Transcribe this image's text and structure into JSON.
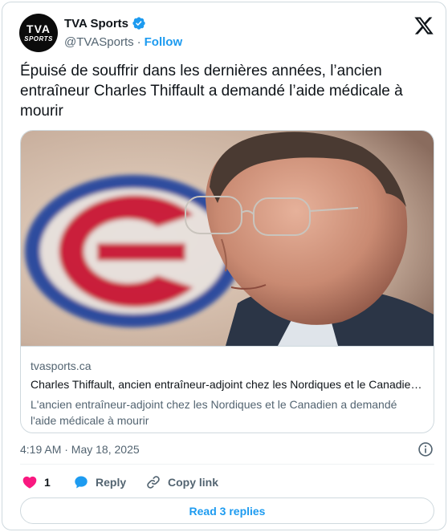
{
  "author": {
    "avatar_line1": "TVA",
    "avatar_line2": "SPORTS",
    "name": "TVA Sports",
    "handle": "@TVASports",
    "separator": "·",
    "follow_label": "Follow",
    "verified": true
  },
  "tweet": {
    "text": "Épuisé de souffrir dans les dernières années, l’ancien entraîneur Charles Thiffault a demandé l’aide médicale à mourir"
  },
  "link_card": {
    "domain": "tvasports.ca",
    "title": "Charles Thiffault, ancien entraîneur-adjoint chez les Nordiques et le Canadien a demandé l'aide médicale à mourir",
    "description": "L'ancien entraîneur-adjoint chez les Nordiques et le Canadien a demandé l'aide médicale à mourir"
  },
  "meta": {
    "timestamp": "4:19 AM · May 18, 2025"
  },
  "actions": {
    "like_count": "1",
    "reply_label": "Reply",
    "copy_label": "Copy link"
  },
  "footer": {
    "read_replies_label": "Read 3 replies"
  },
  "colors": {
    "accent": "#1d9bf0",
    "like": "#f91880",
    "text": "#0f1419",
    "secondary": "#536471",
    "border": "#cfd9de"
  },
  "icons": {
    "verified": "verified-badge-icon",
    "platform": "x-logo-icon",
    "info": "info-icon",
    "like": "heart-icon",
    "reply": "speech-bubble-icon",
    "copy": "link-icon"
  }
}
